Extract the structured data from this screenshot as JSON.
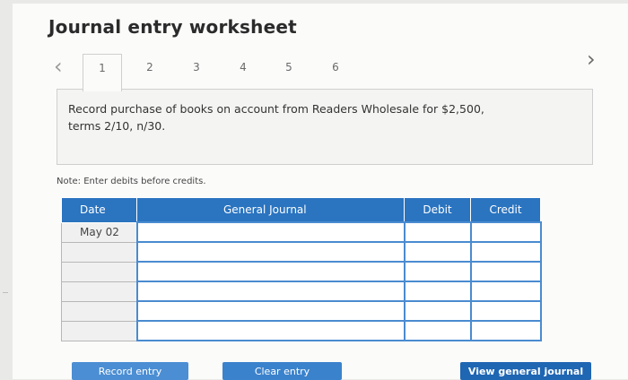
{
  "page": {
    "title": "Journal entry worksheet"
  },
  "nav": {
    "prev_icon": "chevron-left-icon",
    "next_icon": "chevron-right-icon",
    "tabs": [
      "1",
      "2",
      "3",
      "4",
      "5",
      "6"
    ],
    "active_tab": "1"
  },
  "question": {
    "text": "Record purchase of books on account from Readers Wholesale for $2,500, terms 2/10, n/30."
  },
  "note": "Note: Enter debits before credits.",
  "journal": {
    "headers": {
      "date": "Date",
      "general_journal": "General Journal",
      "debit": "Debit",
      "credit": "Credit"
    },
    "rows": [
      {
        "date": "May 02",
        "account": "",
        "debit": "",
        "credit": ""
      },
      {
        "date": "",
        "account": "",
        "debit": "",
        "credit": ""
      },
      {
        "date": "",
        "account": "",
        "debit": "",
        "credit": ""
      },
      {
        "date": "",
        "account": "",
        "debit": "",
        "credit": ""
      },
      {
        "date": "",
        "account": "",
        "debit": "",
        "credit": ""
      },
      {
        "date": "",
        "account": "",
        "debit": "",
        "credit": ""
      }
    ]
  },
  "buttons": {
    "record": "Record entry",
    "clear": "Clear entry",
    "view": "View general journal"
  },
  "colors": {
    "header_blue": "#2a74c0",
    "input_border": "#4a8bd0",
    "button_dark": "#1f66b3"
  }
}
